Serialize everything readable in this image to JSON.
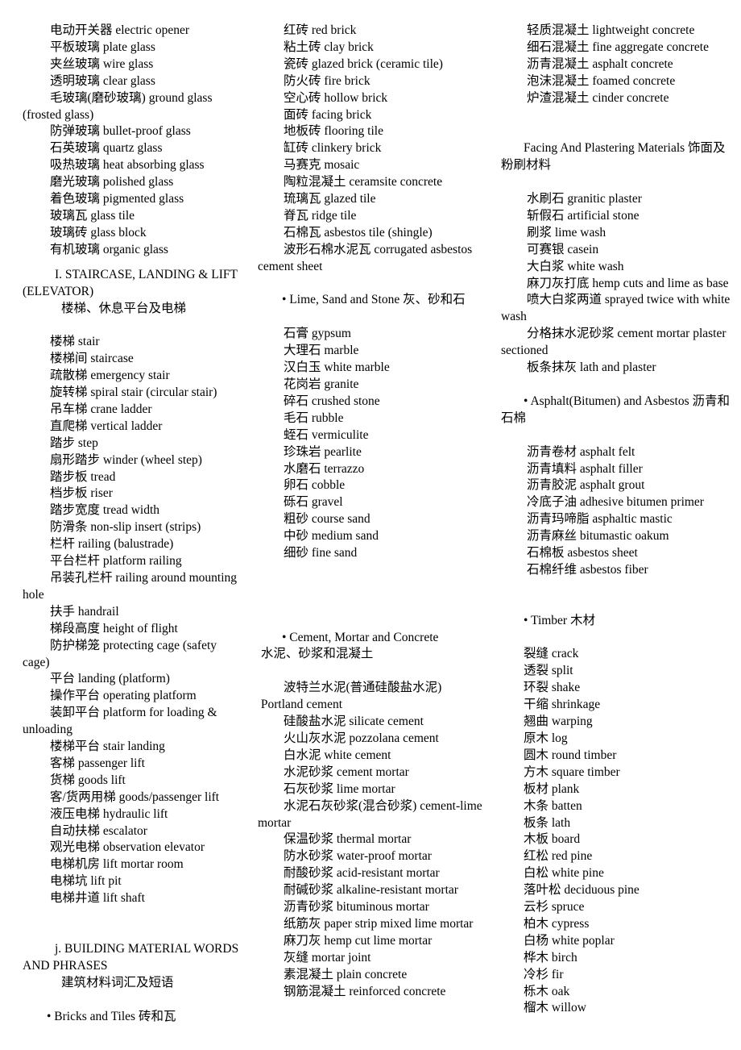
{
  "document": {
    "title": "Building Material Words And Phrases — Chinese/English Glossary",
    "background_color": "#ffffff",
    "text_color": "#000000"
  },
  "columns": [
    {
      "id": "column-1",
      "blocks": [
        {
          "type": "list",
          "name": "glass-terms-list",
          "items": [
            "电动开关器 electric opener",
            "平板玻璃 plate glass",
            "夹丝玻璃 wire glass",
            "透明玻璃 clear glass",
            "毛玻璃(磨砂玻璃) ground glass (frosted glass)",
            "防弹玻璃 bullet-proof glass",
            "石英玻璃 quartz glass",
            "吸热玻璃 heat absorbing glass",
            "磨光玻璃 polished glass",
            "着色玻璃 pigmented glass",
            "玻璃瓦 glass tile",
            "玻璃砖 glass block",
            "有机玻璃 organic glass"
          ]
        },
        {
          "type": "gap",
          "name": "spacer",
          "size": "small"
        },
        {
          "type": "heading",
          "name": "section-heading-staircase",
          "en": "I. STAIRCASE, LANDING & LIFT (ELEVATOR)",
          "cn": "楼梯、休息平台及电梯"
        },
        {
          "type": "gap",
          "name": "spacer",
          "size": "normal"
        },
        {
          "type": "list",
          "name": "staircase-terms-list",
          "items": [
            "楼梯 stair",
            "楼梯间 staircase",
            "疏散梯 emergency stair",
            "旋转梯 spiral stair (circular stair)",
            "吊车梯 crane ladder",
            "直爬梯 vertical ladder",
            "踏步 step",
            "扇形踏步 winder (wheel step)",
            "踏步板 tread",
            "档步板 riser",
            "踏步宽度 tread width",
            "防滑条 non-slip insert (strips)",
            "栏杆 railing (balustrade)",
            "平台栏杆 platform railing",
            "吊装孔栏杆 railing around mounting hole",
            "扶手 handrail",
            "梯段高度 height of flight",
            "防护梯笼 protecting cage (safety cage)",
            "平台 landing (platform)",
            "操作平台 operating platform",
            "装卸平台 platform for loading & unloading",
            "楼梯平台 stair landing",
            "客梯 passenger lift",
            "货梯 goods lift",
            "客/货两用梯 goods/passenger lift",
            "液压电梯 hydraulic lift",
            "自动扶梯 escalator",
            "观光电梯 observation elevator",
            "电梯机房 lift mortar room",
            "电梯坑 lift pit",
            "电梯井道 lift shaft"
          ]
        },
        {
          "type": "gap",
          "name": "spacer",
          "size": "large"
        },
        {
          "type": "heading",
          "name": "section-heading-building-material",
          "en": "j. BUILDING MATERIAL WORDS AND PHRASES",
          "cn": "建筑材料词汇及短语"
        },
        {
          "type": "gap",
          "name": "spacer",
          "size": "normal"
        },
        {
          "type": "bullet",
          "name": "subsection-bricks-and-tiles",
          "text": "• Bricks and Tiles 砖和瓦"
        }
      ]
    },
    {
      "id": "column-2",
      "blocks": [
        {
          "type": "list",
          "name": "brick-tile-terms-list",
          "items": [
            "红砖 red brick",
            "粘土砖 clay brick",
            "瓷砖 glazed brick (ceramic tile)",
            "防火砖 fire brick",
            "空心砖 hollow brick",
            "面砖 facing brick",
            "地板砖 flooring tile",
            "缸砖 clinkery brick",
            "马赛克 mosaic",
            "陶粒混凝土 ceramsite concrete",
            "琉璃瓦 glazed tile",
            "脊瓦 ridge tile",
            "石棉瓦 asbestos tile (shingle)",
            "波形石棉水泥瓦 corrugated asbestos cement sheet"
          ]
        },
        {
          "type": "gap",
          "name": "spacer",
          "size": "normal"
        },
        {
          "type": "bullet",
          "name": "subsection-lime-sand-stone",
          "text": "• Lime, Sand and Stone 灰、砂和石"
        },
        {
          "type": "gap",
          "name": "spacer",
          "size": "normal"
        },
        {
          "type": "list",
          "name": "lime-sand-stone-terms-list",
          "items": [
            "石膏 gypsum",
            "大理石 marble",
            "汉白玉 white marble",
            "花岗岩 granite",
            "碎石 crushed stone",
            "毛石 rubble",
            "蛭石 vermiculite",
            "珍珠岩 pearlite",
            "水磨石 terrazzo",
            "卵石 cobble",
            "砾石 gravel",
            "粗砂 course sand",
            "中砂 medium sand",
            "细砂 fine sand"
          ]
        },
        {
          "type": "gap",
          "name": "spacer",
          "size": "xlarge"
        },
        {
          "type": "bullet",
          "name": "subsection-cement-mortar-concrete",
          "text": "• Cement, Mortar and Concrete\n 水泥、砂浆和混凝土"
        },
        {
          "type": "gap",
          "name": "spacer",
          "size": "normal"
        },
        {
          "type": "list",
          "name": "cement-mortar-concrete-terms-list",
          "items": [
            "波特兰水泥(普通硅酸盐水泥)\n Portland cement",
            "硅酸盐水泥 silicate cement",
            "火山灰水泥 pozzolana cement",
            "白水泥 white cement",
            "水泥砂浆 cement mortar",
            "石灰砂浆 lime mortar",
            "水泥石灰砂浆(混合砂浆) cement-lime mortar",
            "保温砂浆 thermal mortar",
            "防水砂浆 water-proof mortar",
            "耐酸砂浆 acid-resistant mortar",
            "耐碱砂浆 alkaline-resistant mortar",
            "沥青砂浆 bituminous mortar",
            "纸筋灰 paper strip mixed lime mortar",
            "麻刀灰 hemp cut lime mortar",
            "灰缝 mortar joint",
            "素混凝土 plain concrete",
            "钢筋混凝土 reinforced concrete"
          ]
        }
      ]
    },
    {
      "id": "column-3",
      "blocks": [
        {
          "type": "list",
          "name": "concrete-terms-list",
          "items": [
            "轻质混凝土 lightweight concrete",
            "细石混凝土 fine aggregate concrete",
            "沥青混凝土 asphalt concrete",
            "泡沫混凝土 foamed concrete",
            "炉渣混凝土 cinder concrete"
          ]
        },
        {
          "type": "gap",
          "name": "spacer",
          "size": "large"
        },
        {
          "type": "plain-heading",
          "name": "subsection-facing-plastering",
          "text": "Facing And Plastering Materials 饰面及粉刷材料"
        },
        {
          "type": "gap",
          "name": "spacer",
          "size": "normal"
        },
        {
          "type": "list",
          "name": "facing-plastering-terms-list",
          "items": [
            "水刷石 granitic plaster",
            "斩假石 artificial stone",
            "刷浆 lime wash",
            "可赛银 casein",
            "大白浆 white wash",
            "麻刀灰打底 hemp cuts and lime as base",
            "喷大白浆两道 sprayed twice with white wash",
            "分格抹水泥砂浆 cement mortar plaster sectioned",
            "板条抹灰 lath and plaster"
          ]
        },
        {
          "type": "gap",
          "name": "spacer",
          "size": "normal"
        },
        {
          "type": "bullet",
          "name": "subsection-asphalt-asbestos",
          "text": "• Asphalt(Bitumen) and Asbestos 沥青和石棉"
        },
        {
          "type": "gap",
          "name": "spacer",
          "size": "normal"
        },
        {
          "type": "list",
          "name": "asphalt-asbestos-terms-list",
          "items": [
            "沥青卷材 asphalt felt",
            "沥青填料 asphalt filler",
            "沥青胶泥 asphalt grout",
            "冷底子油 adhesive bitumen primer",
            "沥青玛啼脂 asphaltic mastic",
            "沥青麻丝 bitumastic oakum",
            "石棉板 asbestos sheet",
            "石棉纤维 asbestos fiber"
          ]
        },
        {
          "type": "gap",
          "name": "spacer",
          "size": "large"
        },
        {
          "type": "bullet",
          "name": "subsection-timber",
          "text": "• Timber 木材"
        },
        {
          "type": "gap",
          "name": "spacer",
          "size": "normal"
        },
        {
          "type": "list",
          "name": "timber-terms-list",
          "tight": true,
          "items": [
            "裂缝 crack",
            "透裂 split",
            "环裂 shake",
            "干缩 shrinkage",
            "翘曲 warping",
            "原木 log",
            "圆木 round timber",
            "方木 square timber",
            "板材 plank",
            "木条 batten",
            "板条 lath",
            "木板 board",
            "红松 red pine",
            "白松 white pine",
            "落叶松 deciduous pine",
            "云杉 spruce",
            "柏木 cypress",
            "白杨 white poplar",
            "桦木 birch",
            "冷杉 fir",
            "栎木 oak",
            "榴木 willow"
          ]
        }
      ]
    }
  ]
}
